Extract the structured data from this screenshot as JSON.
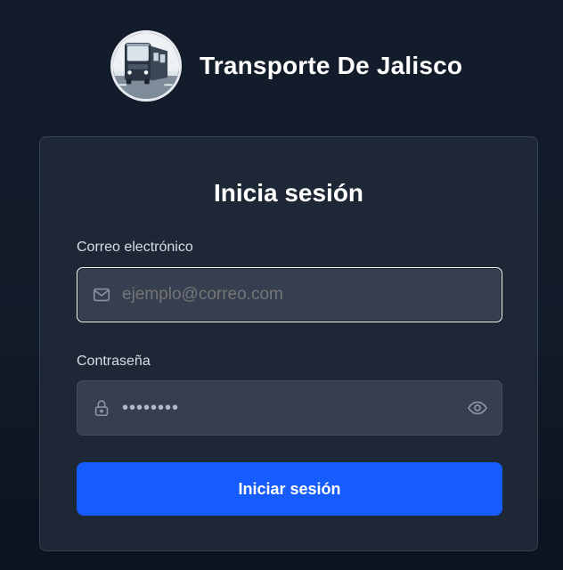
{
  "brand": {
    "name": "Transporte De Jalisco",
    "logo_icon": "bus-logo-icon"
  },
  "login": {
    "title": "Inicia sesión",
    "email": {
      "label": "Correo electrónico",
      "placeholder": "ejemplo@correo.com",
      "value": "",
      "icon": "mail-icon"
    },
    "password": {
      "label": "Contraseña",
      "masked_value": "••••••••",
      "icon": "lock-icon",
      "toggle_icon": "eye-icon"
    },
    "submit_label": "Iniciar sesión"
  },
  "colors": {
    "background": "#131c2b",
    "card": "#1e2736",
    "input": "#363f50",
    "primary": "#165bfb",
    "text": "#ffffff"
  }
}
